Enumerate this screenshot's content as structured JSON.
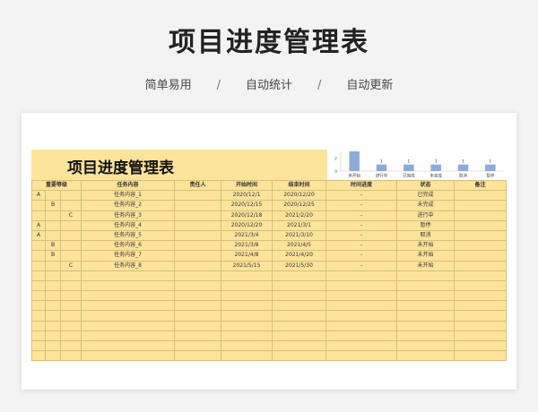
{
  "page": {
    "title": "项目进度管理表",
    "subtitle_items": [
      "简单易用",
      "自动统计",
      "自动更新"
    ],
    "separator": "/"
  },
  "sheet": {
    "title": "项目进度管理表",
    "headers": {
      "level": "重要等级",
      "task": "任务内容",
      "owner": "责任人",
      "start": "开始时间",
      "end": "结束时间",
      "progress": "时间进度",
      "status": "状态",
      "remark": "备注"
    },
    "rows": [
      {
        "a": "A",
        "b": "",
        "c": "",
        "task": "任务内容_1",
        "owner": "",
        "start": "2020/12/1",
        "end": "2020/12/20",
        "progress": "-",
        "status": "已完成",
        "remark": ""
      },
      {
        "a": "",
        "b": "B",
        "c": "",
        "task": "任务内容_2",
        "owner": "",
        "start": "2020/12/15",
        "end": "2020/12/25",
        "progress": "-",
        "status": "未完成",
        "remark": ""
      },
      {
        "a": "",
        "b": "",
        "c": "C",
        "task": "任务内容_3",
        "owner": "",
        "start": "2020/12/18",
        "end": "2021/2/20",
        "progress": "-",
        "status": "进行中",
        "remark": ""
      },
      {
        "a": "A",
        "b": "",
        "c": "",
        "task": "任务内容_4",
        "owner": "",
        "start": "2020/12/20",
        "end": "2021/3/1",
        "progress": "-",
        "status": "暂停",
        "remark": ""
      },
      {
        "a": "A",
        "b": "",
        "c": "",
        "task": "任务内容_5",
        "owner": "",
        "start": "2021/3/4",
        "end": "2021/3/10",
        "progress": "-",
        "status": "取消",
        "remark": ""
      },
      {
        "a": "",
        "b": "B",
        "c": "",
        "task": "任务内容_6",
        "owner": "",
        "start": "2021/3/8",
        "end": "2021/4/5",
        "progress": "-",
        "status": "未开始",
        "remark": ""
      },
      {
        "a": "",
        "b": "B",
        "c": "",
        "task": "任务内容_7",
        "owner": "",
        "start": "2021/4/8",
        "end": "2021/4/20",
        "progress": "-",
        "status": "未开始",
        "remark": ""
      },
      {
        "a": "",
        "b": "",
        "c": "C",
        "task": "任务内容_8",
        "owner": "",
        "start": "2021/5/15",
        "end": "2021/5/30",
        "progress": "-",
        "status": "未开始",
        "remark": ""
      }
    ],
    "empty_rows": 9
  },
  "chart_data": {
    "type": "bar",
    "categories": [
      "未开始",
      "进行中",
      "已完成",
      "未完成",
      "取消",
      "暂停"
    ],
    "values": [
      3,
      1,
      1,
      1,
      1,
      1
    ],
    "data_labels": [
      "",
      "1",
      "1",
      "1",
      "1",
      "1"
    ],
    "y_ticks": [
      "0",
      "2"
    ],
    "ylim": [
      0,
      3
    ],
    "bar_color": "#8eaadb",
    "title": "",
    "xlabel": "",
    "ylabel": ""
  },
  "colors": {
    "sheet_fill": "#fde49b",
    "grid_line": "#d8be7a"
  }
}
